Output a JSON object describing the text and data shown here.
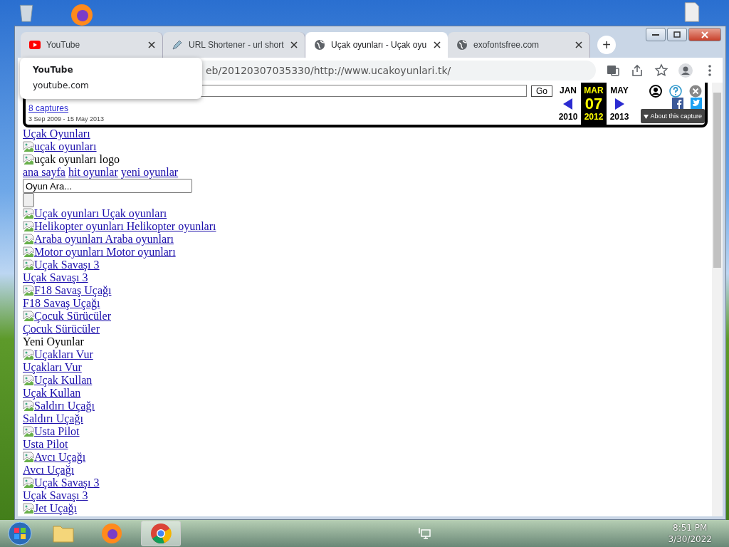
{
  "tabs": [
    {
      "kind": "youtube",
      "title": "YouTube",
      "selected": false
    },
    {
      "kind": "pen",
      "title": "URL Shortener - url short",
      "selected": false
    },
    {
      "kind": "globe",
      "title": "Uçak oyunları - Uçak oyu",
      "selected": true
    },
    {
      "kind": "globe",
      "title": "exofontsfree.com",
      "selected": false
    }
  ],
  "new_tab_button": "+",
  "address_bar": {
    "url": "eb/20120307035330/http://www.ucakoyunlari.tk/"
  },
  "tooltip": {
    "title": "YouTube",
    "subtitle": "youtube.com"
  },
  "wayback": {
    "go_button": "Go",
    "captures_link": "8 captures",
    "date_range": "3 Sep 2009 - 15 May 2013",
    "months": [
      {
        "month": "JAN",
        "year": "2010",
        "selected": false
      },
      {
        "month": "MAR",
        "year": "2012",
        "selected": true
      },
      {
        "month": "MAY",
        "year": "2013",
        "selected": false
      }
    ],
    "day": "07",
    "about_button": "About this capture"
  },
  "page_items": [
    {
      "kind": "link",
      "text": "Uçak Oyunları"
    },
    {
      "kind": "image_link",
      "text": "uçak oyunları"
    },
    {
      "kind": "image_text",
      "text": "uçak oyunları logo"
    },
    {
      "kind": "nav",
      "links": [
        "ana sayfa",
        "hit oyunlar",
        "yeni oyunlar"
      ]
    },
    {
      "kind": "input",
      "value": "Oyun Ara..."
    },
    {
      "kind": "button"
    },
    {
      "kind": "image_link",
      "text": "Uçak oyunları Uçak oyunları"
    },
    {
      "kind": "image_link",
      "text": "Helikopter oyunları Helikopter oyunları"
    },
    {
      "kind": "image_link",
      "text": "Araba oyunları Araba oyunları"
    },
    {
      "kind": "image_link",
      "text": "Motor oyunları Motor oyunları"
    },
    {
      "kind": "image_link",
      "text": "Uçak Savaşı 3"
    },
    {
      "kind": "link",
      "text": "Uçak Savaşı 3"
    },
    {
      "kind": "image_link",
      "text": "F18 Savaş Uçağı"
    },
    {
      "kind": "link",
      "text": "F18 Savaş Uçağı"
    },
    {
      "kind": "image_link",
      "text": "Çocuk Sürücüler"
    },
    {
      "kind": "link",
      "text": "Çocuk Sürücüler"
    },
    {
      "kind": "text",
      "text": "Yeni Oyunlar"
    },
    {
      "kind": "image_link",
      "text": "Uçakları Vur"
    },
    {
      "kind": "link",
      "text": "Uçakları Vur"
    },
    {
      "kind": "image_link",
      "text": "Uçak Kullan"
    },
    {
      "kind": "link",
      "text": "Uçak Kullan"
    },
    {
      "kind": "image_link",
      "text": "Saldırı Uçağı"
    },
    {
      "kind": "link",
      "text": "Saldırı Uçağı"
    },
    {
      "kind": "image_link",
      "text": "Usta Pilot"
    },
    {
      "kind": "link",
      "text": "Usta Pilot"
    },
    {
      "kind": "image_link",
      "text": "Avcı Uçağı"
    },
    {
      "kind": "link",
      "text": "Avcı Uçağı"
    },
    {
      "kind": "image_link",
      "text": "Uçak Savaşı 3"
    },
    {
      "kind": "link",
      "text": "Uçak Savaşı 3"
    },
    {
      "kind": "image_link",
      "text": "Jet Uçağı"
    }
  ],
  "taskbar": {
    "time": "8:51 PM",
    "date": "3/30/2022"
  }
}
